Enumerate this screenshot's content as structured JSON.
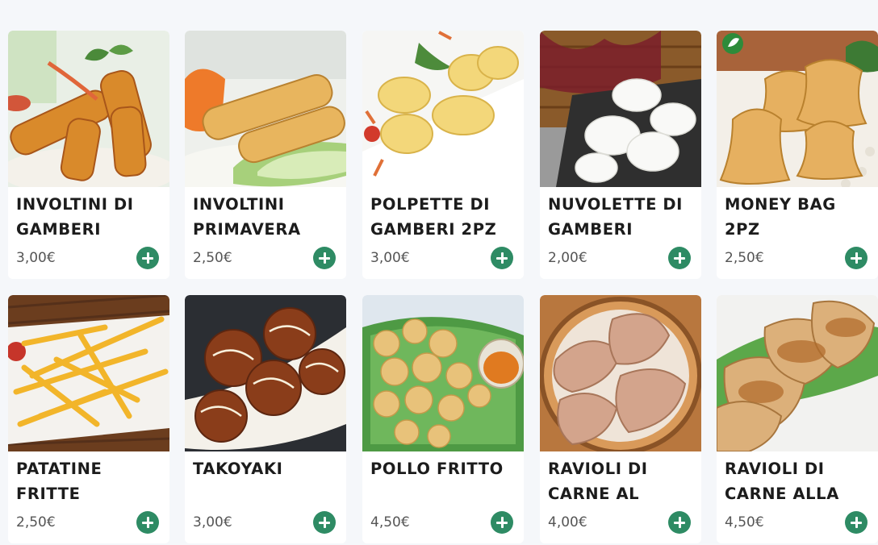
{
  "menu": {
    "items": [
      {
        "name": "INVOLTINI DI GAMBERI",
        "price": "3,00€",
        "image": "fried shrimp rolls"
      },
      {
        "name": "INVOLTINI PRIMAVERA",
        "price": "2,50€",
        "image": "spring rolls"
      },
      {
        "name": "POLPETTE DI GAMBERI 2PZ",
        "price": "3,00€",
        "image": "shrimp balls"
      },
      {
        "name": "NUVOLETTE DI GAMBERI",
        "price": "2,00€",
        "image": "prawn crackers"
      },
      {
        "name": "MONEY BAG 2PZ",
        "price": "2,50€",
        "image": "money bag dumplings"
      },
      {
        "name": "PATATINE FRITTE",
        "price": "2,50€",
        "image": "french fries"
      },
      {
        "name": "TAKOYAKI",
        "price": "3,00€",
        "image": "takoyaki"
      },
      {
        "name": "POLLO FRITTO",
        "price": "4,50€",
        "image": "fried chicken"
      },
      {
        "name": "RAVIOLI DI CARNE AL",
        "price": "4,00€",
        "image": "steamed meat dumplings"
      },
      {
        "name": "RAVIOLI DI CARNE ALLA",
        "price": "4,50€",
        "image": "grilled meat dumplings"
      }
    ]
  },
  "colors": {
    "background": "#f5f7fa",
    "card": "#ffffff",
    "add_button": "#2e8b64",
    "price_text": "#555555",
    "title_text": "#1c1c1c"
  },
  "icons": {
    "add": "plus-circle-icon",
    "badge": "leaf-badge-icon"
  }
}
